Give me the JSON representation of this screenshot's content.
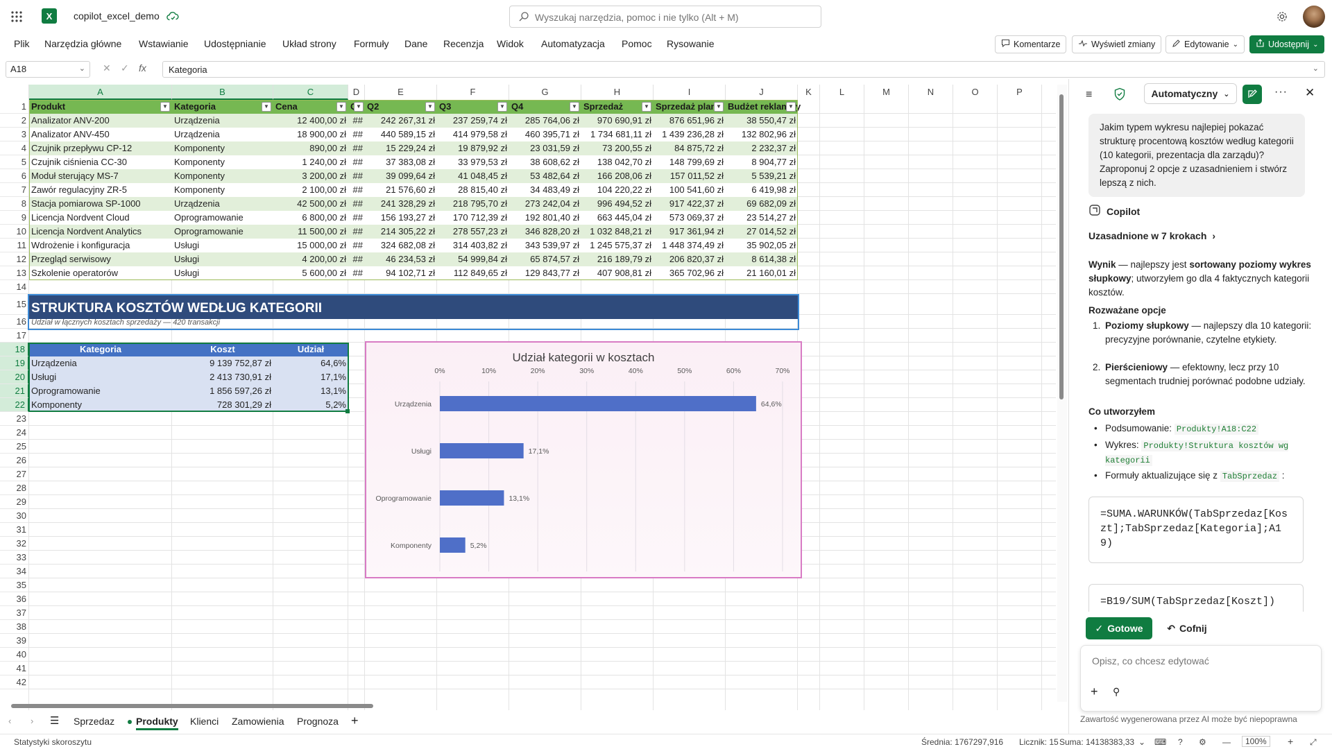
{
  "app": {
    "document_title": "copilot_excel_demo"
  },
  "search": {
    "placeholder": "Wyszukaj narzędzia, pomoc i nie tylko (Alt + M)"
  },
  "menu": {
    "items": [
      "Plik",
      "Narzędzia główne",
      "Wstawianie",
      "Udostępnianie",
      "Układ strony",
      "Formuły",
      "Dane",
      "Recenzja",
      "Widok",
      "Automatyzacja",
      "Pomoc",
      "Rysowanie"
    ],
    "comments_label": "Komentarze",
    "changes_label": "Wyświetl zmiany",
    "editing_label": "Edytowanie",
    "share_label": "Udostępnij"
  },
  "formula_bar": {
    "cell_ref": "A18",
    "content": "Kategoria"
  },
  "grid": {
    "columns": [
      "A",
      "B",
      "C",
      "D",
      "E",
      "F",
      "G",
      "H",
      "I",
      "J",
      "K",
      "L",
      "M",
      "N",
      "O",
      "P"
    ],
    "rows": [
      "1",
      "2",
      "3",
      "4",
      "5",
      "6",
      "7",
      "8",
      "9",
      "10",
      "11",
      "12",
      "13",
      "14",
      "15",
      "16",
      "17",
      "18",
      "19",
      "20",
      "21",
      "22",
      "23",
      "24",
      "25",
      "26",
      "27",
      "28",
      "29",
      "30",
      "31",
      "32",
      "33",
      "34",
      "35",
      "36",
      "37",
      "38",
      "39",
      "40",
      "41",
      "42"
    ],
    "table_headers": [
      "Produkt",
      "Kategoria",
      "Cena",
      "Q",
      "Q2",
      "Q3",
      "Q4",
      "Sprzedaż",
      "Sprzedaż plan",
      "Budżet reklam",
      "y"
    ],
    "products": [
      [
        "Analizator ANV-200",
        "Urządzenia",
        "12 400,00 zł",
        "##",
        "242 267,31 zł",
        "237 259,74 zł",
        "285 764,06 zł",
        "970 690,91 zł",
        "876 651,96 zł",
        "38 550,47 zł"
      ],
      [
        "Analizator ANV-450",
        "Urządzenia",
        "18 900,00 zł",
        "##",
        "440 589,15 zł",
        "414 979,58 zł",
        "460 395,71 zł",
        "1 734 681,11 zł",
        "1 439 236,28 zł",
        "132 802,96 zł"
      ],
      [
        "Czujnik przepływu CP-12",
        "Komponenty",
        "890,00 zł",
        "##",
        "15 229,24 zł",
        "19 879,92 zł",
        "23 031,59 zł",
        "73 200,55 zł",
        "84 875,72 zł",
        "2 232,37 zł"
      ],
      [
        "Czujnik ciśnienia CC-30",
        "Komponenty",
        "1 240,00 zł",
        "##",
        "37 383,08 zł",
        "33 979,53 zł",
        "38 608,62 zł",
        "138 042,70 zł",
        "148 799,69 zł",
        "8 904,77 zł"
      ],
      [
        "Moduł sterujący MS-7",
        "Komponenty",
        "3 200,00 zł",
        "##",
        "39 099,64 zł",
        "41 048,45 zł",
        "53 482,64 zł",
        "166 208,06 zł",
        "157 011,52 zł",
        "5 539,21 zł"
      ],
      [
        "Zawór regulacyjny ZR-5",
        "Komponenty",
        "2 100,00 zł",
        "##",
        "21 576,60 zł",
        "28 815,40 zł",
        "34 483,49 zł",
        "104 220,22 zł",
        "100 541,60 zł",
        "6 419,98 zł"
      ],
      [
        "Stacja pomiarowa SP-1000",
        "Urządzenia",
        "42 500,00 zł",
        "##",
        "241 328,29 zł",
        "218 795,70 zł",
        "273 242,04 zł",
        "996 494,52 zł",
        "917 422,37 zł",
        "69 682,09 zł"
      ],
      [
        "Licencja Nordvent Cloud",
        "Oprogramowanie",
        "6 800,00 zł",
        "##",
        "156 193,27 zł",
        "170 712,39 zł",
        "192 801,40 zł",
        "663 445,04 zł",
        "573 069,37 zł",
        "23 514,27 zł"
      ],
      [
        "Licencja Nordvent Analytics",
        "Oprogramowanie",
        "11 500,00 zł",
        "##",
        "214 305,22 zł",
        "278 557,23 zł",
        "346 828,20 zł",
        "1 032 848,21 zł",
        "917 361,94 zł",
        "27 014,52 zł"
      ],
      [
        "Wdrożenie i konfiguracja",
        "Usługi",
        "15 000,00 zł",
        "##",
        "324 682,08 zł",
        "314 403,82 zł",
        "343 539,97 zł",
        "1 245 575,37 zł",
        "1 448 374,49 zł",
        "35 902,05 zł"
      ],
      [
        "Przegląd serwisowy",
        "Usługi",
        "4 200,00 zł",
        "##",
        "46 234,53 zł",
        "54 999,84 zł",
        "65 874,57 zł",
        "216 189,79 zł",
        "206 820,37 zł",
        "8 614,38 zł"
      ],
      [
        "Szkolenie operatorów",
        "Usługi",
        "5 600,00 zł",
        "##",
        "94 102,71 zł",
        "112 849,65 zł",
        "129 843,77 zł",
        "407 908,81 zł",
        "365 702,96 zł",
        "21 160,01 zł"
      ]
    ],
    "section_title": "STRUKTURA KOSZTÓW WEDŁUG KATEGORII",
    "section_subtitle": "Udział w łącznych kosztach sprzedaży — 420 transakcji",
    "summary_headers": [
      "Kategoria",
      "Koszt",
      "Udział"
    ],
    "summary_rows": [
      [
        "Urządzenia",
        "9 139 752,87 zł",
        "64,6%"
      ],
      [
        "Usługi",
        "2 413 730,91 zł",
        "17,1%"
      ],
      [
        "Oprogramowanie",
        "1 856 597,26 zł",
        "13,1%"
      ],
      [
        "Komponenty",
        "728 301,29 zł",
        "5,2%"
      ]
    ]
  },
  "chart_data": {
    "type": "bar",
    "orientation": "horizontal",
    "title": "Udział kategorii w kosztach",
    "categories": [
      "Urządzenia",
      "Usługi",
      "Oprogramowanie",
      "Komponenty"
    ],
    "values": [
      64.6,
      17.1,
      13.1,
      5.2
    ],
    "data_labels": [
      "64,6%",
      "17,1%",
      "13,1%",
      "5,2%"
    ],
    "x_ticks": [
      "0%",
      "10%",
      "20%",
      "30%",
      "40%",
      "50%",
      "60%",
      "70%"
    ],
    "xlim": [
      0,
      70
    ],
    "bar_color": "#4f6fc8",
    "grid": true,
    "legend": "none"
  },
  "sheet_tabs": {
    "items": [
      "Sprzedaz",
      "Produkty",
      "Klienci",
      "Zamowienia",
      "Prognoza"
    ],
    "active": "Produkty"
  },
  "status_bar": {
    "left": "Statystyki skoroszytu",
    "average": "Średnia: 1767297,916",
    "count": "Licznik: 15",
    "sum": "Suma: 14138383,33",
    "zoom": "100%"
  },
  "copilot": {
    "mode_label": "Automatyczny",
    "user_message": "Jakim typem wykresu najlepiej pokazać strukturę procentową kosztów według kategorii (10 kategorii, prezentacja dla zarządu)? Zaproponuj 2 opcje z uzasadnieniem i stwórz lepszą z nich.",
    "sender": "Copilot",
    "reasoning_link": "Uzasadnione w 7 krokach",
    "result_prefix": "Wynik",
    "result_mid": " — najlepszy jest ",
    "result_bold": "sortowany poziomy wykres słupkowy",
    "result_suffix": "; utworzyłem go dla 4 faktycznych kategorii kosztów.",
    "options_heading": "Rozważane opcje",
    "option1_bold": "Poziomy słupkowy",
    "option1_text": " — najlepszy dla 10 kategorii: precyzyjne porównanie, czytelne etykiety.",
    "option2_bold": "Pierścieniowy",
    "option2_text": " — efektowny, lecz przy 10 segmentach trudniej porównać podobne udziały.",
    "created_heading": "Co utworzyłem",
    "created1_label": "Podsumowanie: ",
    "created1_code": "Produkty!A18:C22",
    "created2_label": "Wykres: ",
    "created2_code": "Produkty!Struktura kosztów wg kategorii",
    "created3_label": "Formuły aktualizujące się z ",
    "created3_code": "TabSprzedaz",
    "created3_suffix": " :",
    "formula1": "=SUMA.WARUNKÓW(TabSprzedaz[Koszt];TabSprzedaz[Kategoria];A19)",
    "formula2": "=B19/SUM(TabSprzedaz[Koszt])",
    "done_label": "Gotowe",
    "undo_label": "Cofnij",
    "prompt_placeholder": "Opisz, co chcesz edytować",
    "disclaimer": "Zawartość wygenerowana przez AI może być niepoprawna"
  }
}
